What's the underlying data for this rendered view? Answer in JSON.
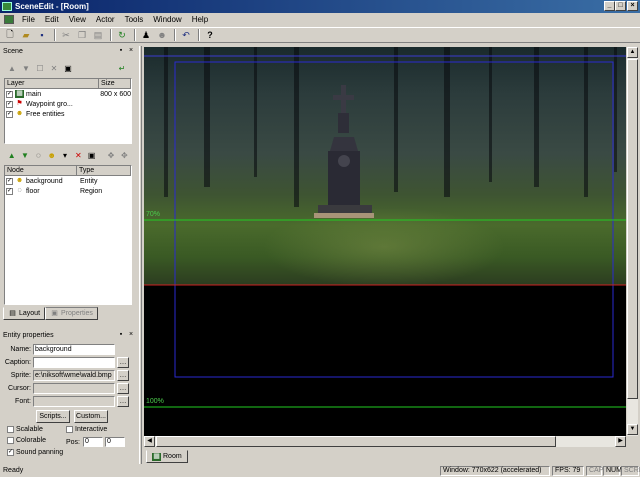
{
  "window": {
    "title": "SceneEdit - [Room]"
  },
  "menu": [
    "File",
    "Edit",
    "View",
    "Actor",
    "Tools",
    "Window",
    "Help"
  ],
  "scene_panel": {
    "title": "Scene",
    "layer_columns": [
      "Layer",
      "Size"
    ],
    "layers": [
      {
        "name": "main",
        "size": "800 x 600",
        "checked": true,
        "icon": "layer-icon"
      },
      {
        "name": "Waypoint gro...",
        "size": "",
        "checked": true,
        "icon": "flag-icon"
      },
      {
        "name": "Free entities",
        "size": "",
        "checked": true,
        "icon": "entity-icon"
      }
    ],
    "node_columns": [
      "Node",
      "Type"
    ],
    "nodes": [
      {
        "name": "background",
        "type": "Entity",
        "checked": true,
        "icon": "entity-icon"
      },
      {
        "name": "floor",
        "type": "Region",
        "checked": true,
        "icon": "region-icon"
      }
    ],
    "tabs": [
      "Layout",
      "Properties"
    ]
  },
  "entity_props": {
    "title": "Entity properties",
    "name_label": "Name:",
    "name_value": "background",
    "caption_label": "Caption:",
    "caption_value": "",
    "sprite_label": "Sprite:",
    "sprite_value": "e:\\niksoft\\wme\\wald.bmp",
    "cursor_label": "Cursor:",
    "cursor_value": "",
    "font_label": "Font:",
    "font_value": "",
    "scripts_btn": "Scripts...",
    "custom_btn": "Custom...",
    "scalable": "Scalable",
    "interactive": "Interactive",
    "colorable": "Colorable",
    "pos_label": "Pos:",
    "pos_x": "0",
    "pos_y": "0",
    "sound_panning": "Sound panning"
  },
  "viewport": {
    "label_70": "70%",
    "label_100": "100%"
  },
  "doc_tab": "Room",
  "status": {
    "ready": "Ready",
    "window": "Window: 770x622 (accelerated)",
    "fps": "FPS: 79",
    "cap": "CAP",
    "num": "NUM",
    "scrl": "SCRL"
  },
  "colors": {
    "title_start": "#0a246a",
    "title_end": "#3a6ea5",
    "green_line": "#22cc22",
    "blue_frame": "#2a2ad0",
    "red_line": "#cc2222"
  }
}
